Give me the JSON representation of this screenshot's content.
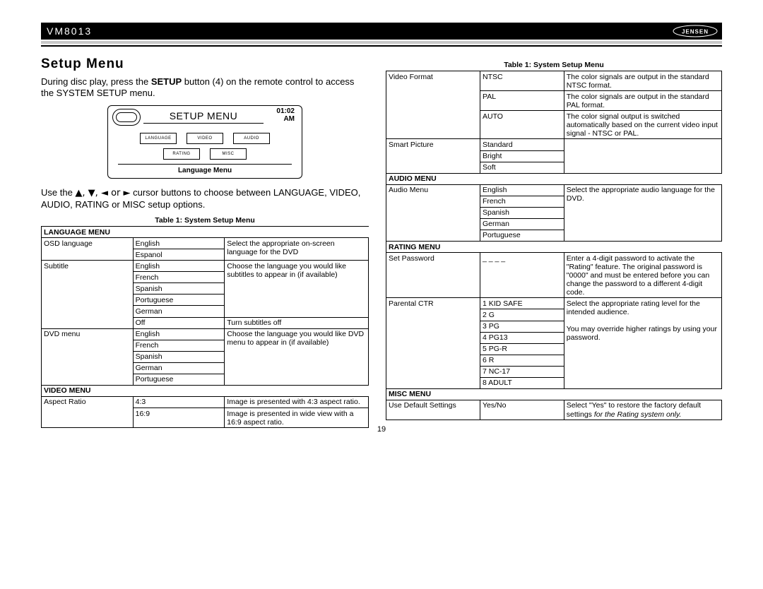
{
  "header": {
    "model": "VM8013",
    "brand": "JENSEN"
  },
  "section_title": "Setup Menu",
  "intro": {
    "part1": "During disc play, press the ",
    "bold1": "SETUP",
    "part2": " button (4) on the remote control to access the SYSTEM SETUP menu."
  },
  "screen": {
    "title": "SETUP MENU",
    "clock_time": "01:02",
    "clock_ampm": "AM",
    "tabs_row1": [
      "LANGUAGE",
      "VIDEO",
      "AUDIO"
    ],
    "tabs_row2": [
      "RATING",
      "MISC"
    ],
    "sub_label": "Language Menu"
  },
  "cursor_text": {
    "p1": "Use the ",
    "arrows": "▲, ▼, ◄ or ►",
    "p2": " cursor buttons to choose between LANGUAGE, VIDEO, AUDIO, RATING or MISC setup options."
  },
  "table_caption_left": "Table 1: System Setup Menu",
  "table_caption_right": "Table 1: System Setup Menu",
  "left_table": {
    "sections": [
      {
        "title": "LANGUAGE MENU",
        "rows": [
          {
            "c1": "OSD language",
            "c2": "English",
            "c3": "Select the appropriate on-screen language for the DVD",
            "row_span_c1": 2,
            "row_span_c3": 2
          },
          {
            "c2": "Espanol"
          },
          {
            "c1": "Subtitle",
            "c2": "English",
            "c3": "Choose the language you would like subtitles to appear in (if available)",
            "row_span_c1": 6,
            "row_span_c3": 5
          },
          {
            "c2": "French"
          },
          {
            "c2": "Spanish"
          },
          {
            "c2": "Portuguese"
          },
          {
            "c2": "German"
          },
          {
            "c2": "Off",
            "c3": "Turn subtitles off"
          },
          {
            "c1": "DVD menu",
            "c2": "English",
            "c3": "Choose the language you would like DVD menu to appear in (if available)",
            "row_span_c1": 5,
            "row_span_c3": 5
          },
          {
            "c2": "French"
          },
          {
            "c2": "Spanish"
          },
          {
            "c2": "German"
          },
          {
            "c2": "Portuguese"
          }
        ]
      },
      {
        "title": "VIDEO MENU",
        "rows": [
          {
            "c1": "Aspect Ratio",
            "c2": "4:3",
            "c3": "Image is presented with 4:3 aspect ratio.",
            "row_span_c1": 2
          },
          {
            "c2": "16:9",
            "c3": "Image is presented in wide view with a 16:9 aspect ratio."
          }
        ]
      }
    ]
  },
  "right_table": {
    "rows_video": [
      {
        "c1": "Video Format",
        "c2": "NTSC",
        "c3": "The color signals are output in the standard NTSC format.",
        "row_span_c1": 3
      },
      {
        "c2": "PAL",
        "c3": "The color signals are output in the standard PAL format."
      },
      {
        "c2": "AUTO",
        "c3": "The color signal output is switched automatically based on the current video input signal - NTSC or PAL."
      },
      {
        "c1": "Smart Picture",
        "c2": "Standard",
        "c3": "",
        "row_span_c1": 3,
        "row_span_c3": 3
      },
      {
        "c2": "Bright"
      },
      {
        "c2": "Soft"
      }
    ],
    "audio_title": "AUDIO MENU",
    "rows_audio": [
      {
        "c1": "Audio Menu",
        "c2": "English",
        "c3": "Select the appropriate audio language for the DVD.",
        "row_span_c1": 5,
        "row_span_c3": 5
      },
      {
        "c2": "French"
      },
      {
        "c2": "Spanish"
      },
      {
        "c2": "German"
      },
      {
        "c2": "Portuguese"
      }
    ],
    "rating_title": "RATING MENU",
    "rows_rating": [
      {
        "c1": "Set Password",
        "c2": "_ _ _ _",
        "c3": "Enter a 4-digit password to activate the \"Rating\" feature. The original password is \"0000\" and must be entered before you can change the password to a different 4-digit code."
      },
      {
        "c1": "Parental CTR",
        "c2": "1 KID SAFE",
        "c3_a": "Select the appropriate rating level for the intended audience.",
        "c3_b": "You may override higher ratings by using your password.",
        "row_span_c1": 8,
        "row_span_c3": 8
      },
      {
        "c2": "2 G"
      },
      {
        "c2": "3 PG"
      },
      {
        "c2": "4 PG13"
      },
      {
        "c2": "5 PG-R"
      },
      {
        "c2": "6 R"
      },
      {
        "c2": "7 NC-17"
      },
      {
        "c2": "8 ADULT"
      }
    ],
    "misc_title": "MISC MENU",
    "rows_misc": [
      {
        "c1": "Use Default Settings",
        "c2": "Yes/No",
        "c3_plain": "Select \"Yes\" to restore the factory default settings ",
        "c3_italic": "for the Rating system only."
      }
    ]
  },
  "page_number": "19"
}
